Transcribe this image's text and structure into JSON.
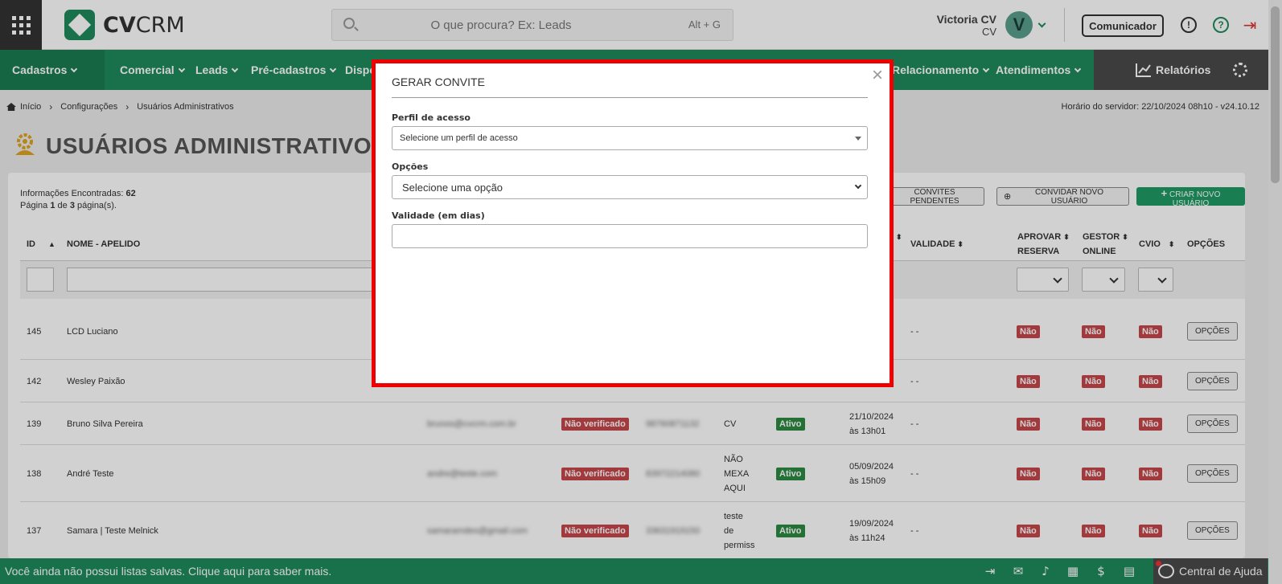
{
  "header": {
    "brand": {
      "bold": "CV",
      "rest": "CRM"
    },
    "search_placeholder": "O que procura? Ex: Leads",
    "search_shortcut": "Alt + G",
    "user_name": "Victoria CV",
    "user_sub": "CV",
    "avatar_letter": "V",
    "comunicador": "Comunicador",
    "info_glyph": "!",
    "help_glyph": "?"
  },
  "nav": {
    "items": [
      "Cadastros",
      "Comercial",
      "Leads",
      "Pré-cadastros",
      "Dispo",
      "Relacionamento",
      "Atendimentos"
    ],
    "reports": "Relatórios"
  },
  "breadcrumb": {
    "items": [
      "Início",
      "Configurações",
      "Usuários Administrativos"
    ],
    "server_time": "Horário do servidor: 22/10/2024 08h10 - v24.10.12"
  },
  "page": {
    "title": "USUÁRIOS ADMINISTRATIVOS",
    "info_label": "Informações Encontradas:",
    "info_count": "62",
    "pag_pre": "Página",
    "pag_current": "1",
    "pag_mid": "de",
    "pag_total": "3",
    "pag_post": "página(s).",
    "btn_pending": "CONVITES PENDENTES",
    "btn_invite": "CONVIDAR NOVO USUÁRIO",
    "btn_create": "CRIAR NOVO USUÁRIO"
  },
  "table": {
    "headers": {
      "id": "ID",
      "name": "NOME - APELIDO",
      "validade": "VALIDADE",
      "aprovar_1": "APROVAR",
      "aprovar_2": "RESERVA",
      "gestor_1": "GESTOR",
      "gestor_2": "ONLINE",
      "cvio": "CVIO",
      "opcoes": "OPÇÕES"
    },
    "rows": [
      {
        "id": "145",
        "name": "LCD Luciano",
        "validade": "- -",
        "aprovar": "Não",
        "gestor": "Não",
        "cvio": "Não",
        "opcoes": "OPÇÕES"
      },
      {
        "id": "142",
        "name": "Wesley Paixão",
        "validade": "- -",
        "aprovar": "Não",
        "gestor": "Não",
        "cvio": "Não",
        "opcoes": "OPÇÕES"
      },
      {
        "id": "139",
        "name": "Bruno Silva Pereira",
        "email": "brunos@cvcrm.com.br",
        "verif": "Não verificado",
        "phone": "98760871132",
        "perfil": "CV",
        "status": "Ativo",
        "date1": "21/10/2024",
        "date2": "às 13h01",
        "validade": "- -",
        "aprovar": "Não",
        "gestor": "Não",
        "cvio": "Não",
        "opcoes": "OPÇÕES"
      },
      {
        "id": "138",
        "name": "André Teste",
        "email": "andre@teste.com",
        "verif": "Não verificado",
        "phone": "83972214080",
        "perfil1": "NÃO",
        "perfil2": "MEXA",
        "perfil3": "AQUI",
        "status": "Ativo",
        "date1": "05/09/2024",
        "date2": "às 15h09",
        "validade": "- -",
        "aprovar": "Não",
        "gestor": "Não",
        "cvio": "Não",
        "opcoes": "OPÇÕES"
      },
      {
        "id": "137",
        "name": "Samara | Teste Melnick",
        "email": "samaramdes@gmail.com",
        "verif": "Não verificado",
        "phone": "33631919150",
        "perfil1": "teste",
        "perfil2": "de",
        "perfil3": "permiss",
        "status": "Ativo",
        "date1": "19/09/2024",
        "date2": "às 11h24",
        "validade": "- -",
        "aprovar": "Não",
        "gestor": "Não",
        "cvio": "Não",
        "opcoes": "OPÇÕES"
      }
    ]
  },
  "modal": {
    "title": "GERAR CONVITE",
    "close": "×",
    "perfil_label": "Perfil de acesso",
    "perfil_placeholder": "Selecione um perfil de acesso",
    "opcoes_label": "Opções",
    "opcoes_value": "Selecione uma opção",
    "validade_label": "Validade (em dias)",
    "validade_value": ""
  },
  "footer": {
    "text": "Você ainda não possui listas salvas. Clique aqui para saber mais.",
    "dollar": "$",
    "help": "Central de Ajuda"
  },
  "colors": {
    "brand_green": "#1f8a5c",
    "modal_border": "#e00000",
    "badge_red": "#c6464a",
    "badge_green": "#2d8a43"
  }
}
